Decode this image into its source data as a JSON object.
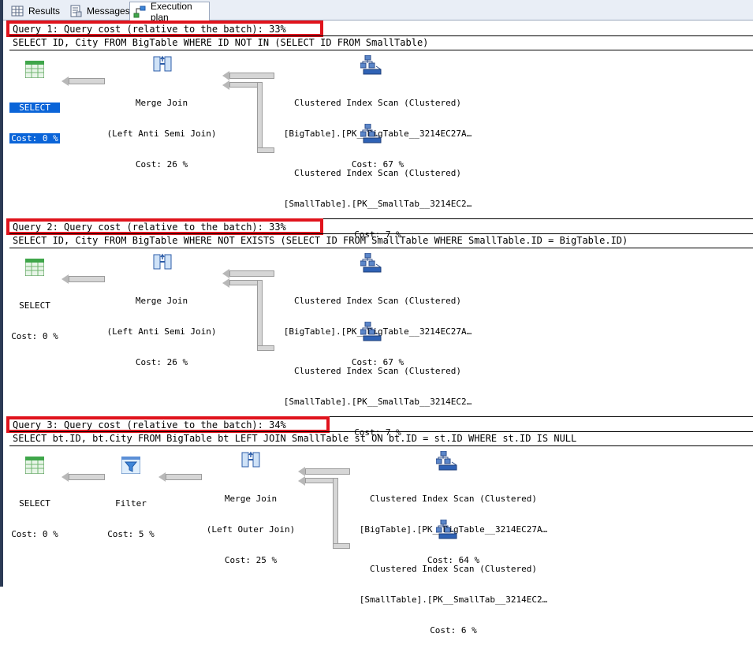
{
  "tabs": [
    {
      "label": "Results",
      "icon": "grid-icon"
    },
    {
      "label": "Messages",
      "icon": "messages-icon"
    },
    {
      "label": "Execution plan",
      "icon": "execution-plan-icon"
    }
  ],
  "queries": [
    {
      "header": "Query 1: Query cost (relative to the batch): 33%",
      "sql": "SELECT ID, City FROM BigTable WHERE ID NOT IN (SELECT ID FROM SmallTable)",
      "nodes": {
        "select": {
          "line1": "SELECT",
          "line2": "Cost: 0 %"
        },
        "merge": {
          "line1": "Merge Join",
          "line2": "(Left Anti Semi Join)",
          "line3": "Cost: 26 %"
        },
        "scan1": {
          "line1": "Clustered Index Scan (Clustered)",
          "line2": "[BigTable].[PK__BigTable__3214EC27A…",
          "line3": "Cost: 67 %"
        },
        "scan2": {
          "line1": "Clustered Index Scan (Clustered)",
          "line2": "[SmallTable].[PK__SmallTab__3214EC2…",
          "line3": "Cost: 7 %"
        }
      }
    },
    {
      "header": "Query 2: Query cost (relative to the batch): 33%",
      "sql": "SELECT ID, City FROM BigTable WHERE NOT EXISTS (SELECT ID FROM SmallTable WHERE SmallTable.ID = BigTable.ID)",
      "nodes": {
        "select": {
          "line1": "SELECT",
          "line2": "Cost: 0 %"
        },
        "merge": {
          "line1": "Merge Join",
          "line2": "(Left Anti Semi Join)",
          "line3": "Cost: 26 %"
        },
        "scan1": {
          "line1": "Clustered Index Scan (Clustered)",
          "line2": "[BigTable].[PK__BigTable__3214EC27A…",
          "line3": "Cost: 67 %"
        },
        "scan2": {
          "line1": "Clustered Index Scan (Clustered)",
          "line2": "[SmallTable].[PK__SmallTab__3214EC2…",
          "line3": "Cost: 7 %"
        }
      }
    },
    {
      "header": "Query 3: Query cost (relative to the batch): 34%",
      "sql": "SELECT bt.ID, bt.City FROM BigTable bt LEFT JOIN SmallTable st ON bt.ID = st.ID WHERE st.ID IS NULL",
      "nodes": {
        "select": {
          "line1": "SELECT",
          "line2": "Cost: 0 %"
        },
        "filter": {
          "line1": "Filter",
          "line2": "Cost: 5 %"
        },
        "merge": {
          "line1": "Merge Join",
          "line2": "(Left Outer Join)",
          "line3": "Cost: 25 %"
        },
        "scan1": {
          "line1": "Clustered Index Scan (Clustered)",
          "line2": "[BigTable].[PK__BigTable__3214EC27A…",
          "line3": "Cost: 64 %"
        },
        "scan2": {
          "line1": "Clustered Index Scan (Clustered)",
          "line2": "[SmallTable].[PK__SmallTab__3214EC2…",
          "line3": "Cost: 6 %"
        }
      }
    }
  ],
  "colors": {
    "highlight_box": "#e0131c",
    "selected_node": "#0a64d8"
  }
}
